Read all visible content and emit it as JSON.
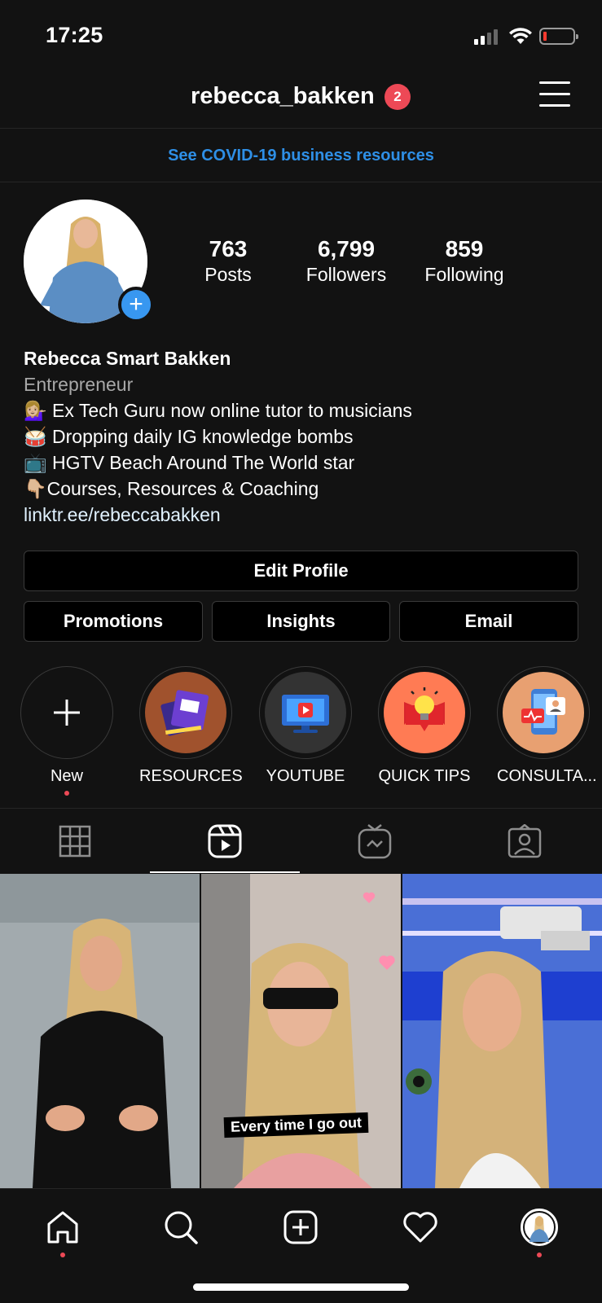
{
  "status_bar": {
    "time": "17:25"
  },
  "header": {
    "username": "rebecca_bakken",
    "notification_count": "2"
  },
  "banner": {
    "text": "See COVID-19 business resources"
  },
  "profile": {
    "stats": [
      {
        "value": "763",
        "label": "Posts"
      },
      {
        "value": "6,799",
        "label": "Followers"
      },
      {
        "value": "859",
        "label": "Following"
      }
    ],
    "name": "Rebecca Smart Bakken",
    "category": "Entrepreneur",
    "bio_lines": [
      "💁🏼‍♀️ Ex Tech Guru now online tutor to musicians",
      "🥁 Dropping daily IG knowledge bombs",
      "📺 HGTV Beach Around The World star",
      "👇🏼Courses, Resources & Coaching"
    ],
    "link": "linktr.ee/rebeccabakken"
  },
  "buttons": {
    "edit_profile": "Edit Profile",
    "promotions": "Promotions",
    "insights": "Insights",
    "email": "Email"
  },
  "highlights": [
    {
      "label": "New",
      "icon": "plus-icon"
    },
    {
      "label": "RESOURCES",
      "icon": "books-icon",
      "color": "#a0522d"
    },
    {
      "label": "YOUTUBE",
      "icon": "video-player-icon",
      "color": "#333333"
    },
    {
      "label": "QUICK TIPS",
      "icon": "lightbulb-icon",
      "color": "#ff7b54"
    },
    {
      "label": "CONSULTA...",
      "icon": "phone-chat-icon",
      "color": "#e8a071"
    }
  ],
  "tabs": [
    {
      "name": "grid",
      "icon": "grid-icon"
    },
    {
      "name": "reels",
      "icon": "reels-icon",
      "active": true
    },
    {
      "name": "igtv",
      "icon": "igtv-icon"
    },
    {
      "name": "tagged",
      "icon": "tagged-icon"
    }
  ],
  "posts": [
    {
      "caption": ""
    },
    {
      "caption": "Every time I go out"
    },
    {
      "caption": ""
    }
  ],
  "bottom_nav": [
    {
      "name": "home",
      "icon": "home-icon"
    },
    {
      "name": "search",
      "icon": "search-icon"
    },
    {
      "name": "create",
      "icon": "add-post-icon"
    },
    {
      "name": "activity",
      "icon": "heart-icon"
    },
    {
      "name": "profile",
      "icon": "profile-avatar-icon"
    }
  ]
}
